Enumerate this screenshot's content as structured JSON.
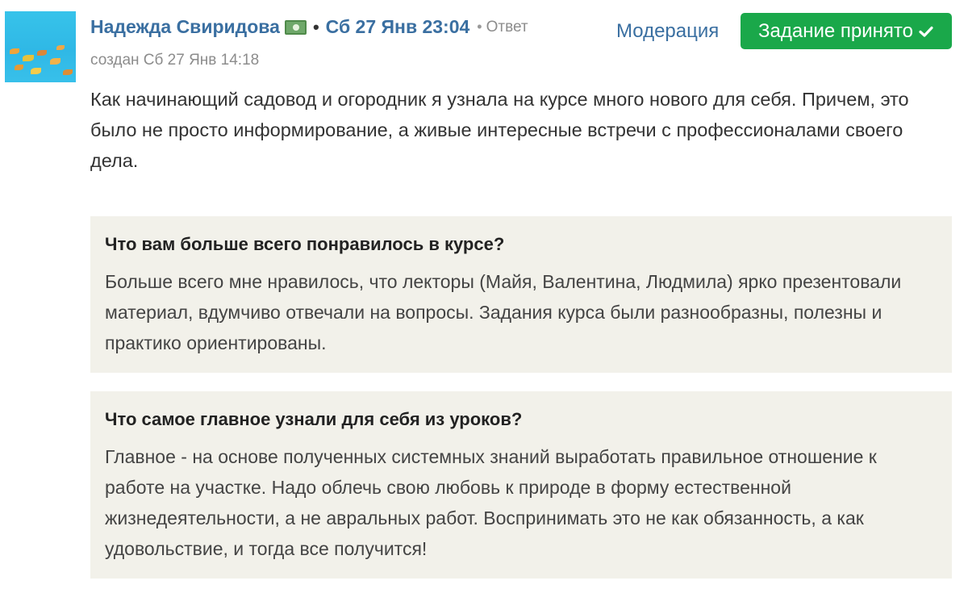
{
  "post": {
    "author": "Надежда Свиридова",
    "separator": "•",
    "date": "Сб 27 Янв 23:04",
    "reply_separator": "•",
    "reply_label": "Ответ",
    "created": "создан Сб 27 Янв 14:18",
    "body": "Как начинающий садовод и огородник я узнала на курсе много нового для себя. Причем, это было не просто информирование, а живые интересные встречи с профессионалами своего дела."
  },
  "actions": {
    "moderation_label": "Модерация",
    "accepted_label": "Задание принято"
  },
  "icons": {
    "author_badge": "money-icon",
    "accepted": "check-icon"
  },
  "qa": [
    {
      "question": "Что вам больше всего понравилось в курсе?",
      "answer": "Больше всего мне нравилось, что лекторы (Майя, Валентина, Людмила) ярко презентовали материал, вдумчиво отвечали на вопросы. Задания курса были разнообразны, полезны и практико ориентированы."
    },
    {
      "question": "Что самое главное узнали для себя из уроков?",
      "answer": "Главное - на основе полученных системных знаний выработать правильное отношение к работе на участке. Надо облечь свою любовь к природе в форму естественной жизнедеятельности, а не авральных работ. Воспринимать это не как обязанность, а как удовольствие, и тогда все получится!"
    }
  ],
  "colors": {
    "link": "#3a6fa1",
    "accepted_bg": "#1aa84a",
    "qa_bg": "#f2f1ea"
  }
}
